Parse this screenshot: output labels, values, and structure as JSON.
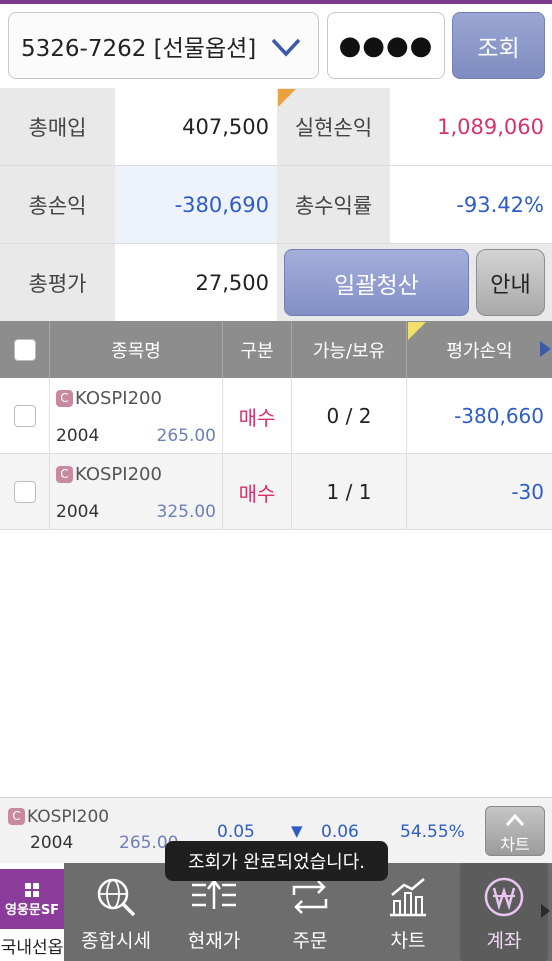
{
  "account": {
    "selected": "5326-7262 [선물옵션]",
    "password_mask": "●●●●",
    "query_label": "조회"
  },
  "summary": {
    "total_purchase_label": "총매입",
    "total_purchase_value": "407,500",
    "realized_pnl_label": "실현손익",
    "realized_pnl_value": "1,089,060",
    "total_pnl_label": "총손익",
    "total_pnl_value": "-380,690",
    "total_return_label": "총수익률",
    "total_return_value": "-93.42%",
    "total_eval_label": "총평가",
    "total_eval_value": "27,500",
    "liquidate_label": "일괄청산",
    "info_label": "안내"
  },
  "table": {
    "headers": {
      "name": "종목명",
      "side": "구분",
      "qty": "가능/보유",
      "pnl": "평가손익"
    },
    "rows": [
      {
        "badge": "C",
        "name": "KOSPI200",
        "code": "2004",
        "strike": "265.00",
        "side": "매수",
        "qty": "0 / 2",
        "pnl": "-380,660"
      },
      {
        "badge": "C",
        "name": "KOSPI200",
        "code": "2004",
        "strike": "325.00",
        "side": "매수",
        "qty": "1 / 1",
        "pnl": "-30"
      }
    ]
  },
  "ticker": {
    "badge": "C",
    "name": "KOSPI200",
    "code": "2004",
    "strike": "265.00",
    "price": "0.05",
    "arrow": "▼",
    "change": "0.06",
    "rate": "54.55%",
    "chart_label": "차트"
  },
  "toast": "조회가 완료되었습니다.",
  "nav": {
    "home_logo": "영웅문SF",
    "home_label": "국내선옵",
    "items": [
      "종합시세",
      "현재가",
      "주문",
      "차트",
      "계좌"
    ]
  },
  "colors": {
    "accent_purple": "#8b3b9a",
    "profit_red": "#d6336c",
    "loss_blue": "#2f5cc4"
  }
}
